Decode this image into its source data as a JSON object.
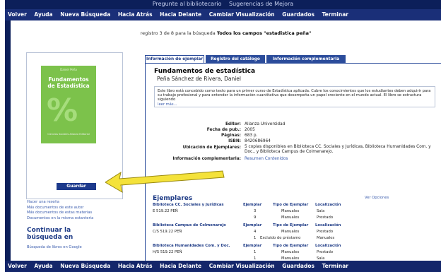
{
  "top_links": [
    "Pregunte al bibliotecario",
    "Sugerencias de Mejora"
  ],
  "nav": [
    "Volver",
    "Ayuda",
    "Nueva Búsqueda",
    "Hacia Atrás",
    "Hacia Delante",
    "Cambiar Visualización",
    "Guardados",
    "Terminar"
  ],
  "record_line": {
    "prefix": "registro 3 de 8 para la búsqueda",
    "query": "Todos los campos \"estadistica peña\""
  },
  "cover": {
    "author": "Daniel Peña",
    "title_line1": "Fundamentos",
    "title_line2": "de Estadística",
    "percent": "%",
    "publisher": "Ciencias Sociales Alianza Editorial"
  },
  "guardar_label": "Guardar",
  "side_links": [
    "Hacer una reseña",
    "Más documentos de este autor",
    "Más documentos de estas materias",
    "Documentos en la misma estantería"
  ],
  "continuar": {
    "line1": "Continuar la",
    "line2": "búsqueda en",
    "google": "Búsqueda de libros en Google"
  },
  "tabs": [
    "Información de ejemplar",
    "Registro del catálogo",
    "Información complementaria"
  ],
  "book": {
    "title": "Fundamentos de estadística",
    "author": "Peña Sánchez de Rivera, Daniel",
    "summary": "Este libro está concebido como texto para un primer curso de Estadística aplicada. Cubre los conocimientos que los estudiantes deben adquirir para su trabajo profesional y para entender la información cuantitativa que desempeña un papel creciente en el mundo actual. El libro se estructura siguiendo",
    "more": "leer más..."
  },
  "details": [
    {
      "label": "Editor:",
      "value": "Alianza Universidad"
    },
    {
      "label": "Fecha de pub.:",
      "value": "2005"
    },
    {
      "label": "Páginas:",
      "value": "683 p."
    },
    {
      "label": "ISBN:",
      "value": "8420686964"
    },
    {
      "label": "Ubicación de Ejemplares:",
      "value": "5 copias disponibles en Biblioteca CC. Sociales y Jurídicas, Biblioteca Humanidades Com. y Doc., y Biblioteca Campus de Colmenarejo."
    },
    {
      "label": "Información complementaria:",
      "value": "Resumen  Contenidos"
    }
  ],
  "ejemplares": {
    "title": "Ejemplares",
    "ver_opciones": "Ver Opciones",
    "groups": [
      {
        "library": "Biblioteca CC. Sociales y Jurídicas",
        "h_ej": "Ejemplar",
        "h_tipo": "Tipo de Ejemplar",
        "h_loc": "Localización",
        "rows": [
          {
            "sig": "E 519.22 PEÑ",
            "n": "3",
            "tipo": "Manuales",
            "loc": "Sala"
          },
          {
            "sig": "",
            "n": "9",
            "tipo": "Manuales",
            "loc": "Prestado"
          }
        ]
      },
      {
        "library": "Biblioteca Campus de Colmenarejo",
        "h_ej": "Ejemplar",
        "h_tipo": "Tipo de Ejemplar",
        "h_loc": "Localización",
        "rows": [
          {
            "sig": "C/S 519.22 PEÑ",
            "n": "4",
            "tipo": "Manuales",
            "loc": "Prestado"
          },
          {
            "sig": "",
            "n": "1",
            "tipo": "Excluido de préstamo",
            "loc": "Manuales"
          }
        ]
      },
      {
        "library": "Biblioteca Humanidades Com. y Doc.",
        "h_ej": "Ejemplar",
        "h_tipo": "Tipo de Ejemplar",
        "h_loc": "Localización",
        "rows": [
          {
            "sig": "H/S 519.22 PEÑ",
            "n": "1",
            "tipo": "Manuales",
            "loc": "Prestado"
          },
          {
            "sig": "",
            "n": "1",
            "tipo": "Manuales",
            "loc": "Sala"
          }
        ]
      }
    ]
  }
}
